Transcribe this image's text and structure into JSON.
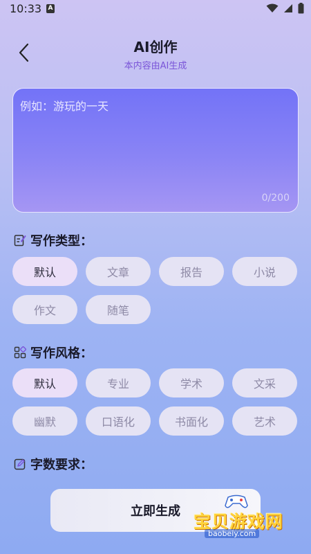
{
  "status_bar": {
    "time": "10:33",
    "notification_badge": "A"
  },
  "header": {
    "title": "AI创作",
    "subtitle": "本内容由AI生成"
  },
  "prompt": {
    "placeholder": "例如：游玩的一天",
    "value": "",
    "char_count": "0/200"
  },
  "writing_type": {
    "heading": "写作类型：",
    "options": [
      "默认",
      "文章",
      "报告",
      "小说",
      "作文",
      "随笔"
    ],
    "selected": "默认"
  },
  "writing_style": {
    "heading": "写作风格：",
    "options": [
      "默认",
      "专业",
      "学术",
      "文采",
      "幽默",
      "口语化",
      "书面化",
      "艺术"
    ],
    "selected": "默认"
  },
  "word_count": {
    "heading": "字数要求："
  },
  "generate_button": {
    "label": "立即生成"
  },
  "watermark": {
    "name": "宝贝游戏网",
    "url": "baobeiy.com"
  },
  "colors": {
    "accent": "#7a55d8",
    "prompt_gradient_top": "#7373f7",
    "chip_selected": "#ebdff8",
    "chip": "#e5e3f4"
  }
}
